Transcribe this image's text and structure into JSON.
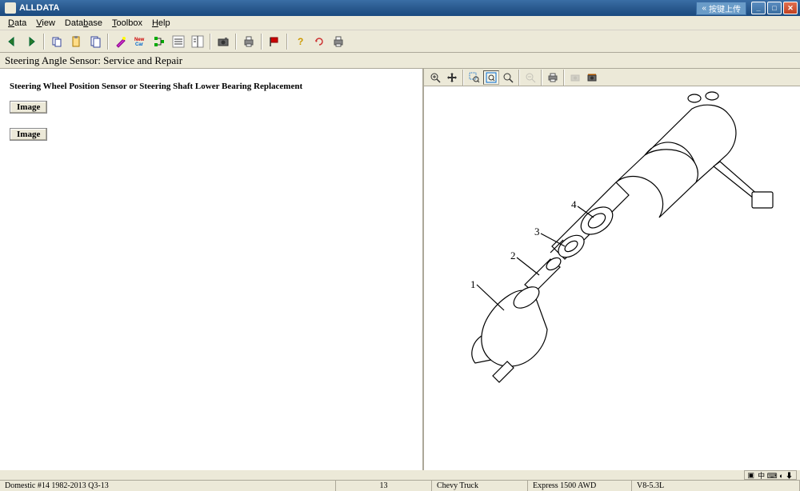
{
  "window": {
    "title": "ALLDATA",
    "upload_badge": "按键上传"
  },
  "menu": {
    "data": "Data",
    "view": "View",
    "database": "Database",
    "toolbox": "Toolbox",
    "help": "Help"
  },
  "heading": "Steering Angle Sensor:  Service and Repair",
  "article": {
    "title": "Steering Wheel Position Sensor or Steering Shaft Lower Bearing Replacement",
    "image_btn": "Image"
  },
  "status": {
    "source": "Domestic #14 1982-2013 Q3-13",
    "page": "13",
    "make": "Chevy Truck",
    "model": "Express 1500 AWD",
    "engine": "V8-5.3L",
    "tray": "中 ⌨ ◐ ⬇"
  },
  "diagram": {
    "labels": [
      "1",
      "2",
      "3",
      "4"
    ]
  }
}
